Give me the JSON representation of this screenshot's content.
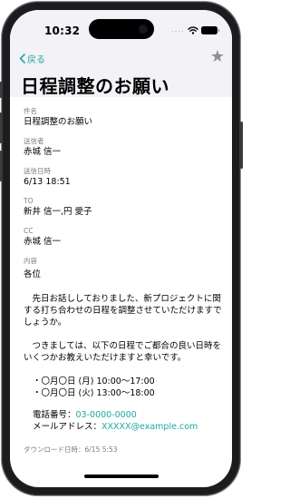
{
  "status_bar": {
    "time": "10:32",
    "dots": "...."
  },
  "nav": {
    "back_label": "戻る"
  },
  "title": "日程調整のお願い",
  "fields": [
    {
      "label": "件名",
      "value": "日程調整のお願い"
    },
    {
      "label": "送信者",
      "value": "赤城 信一"
    },
    {
      "label": "送信日時",
      "value": "6/13 18:51"
    },
    {
      "label": "TO",
      "value": "新井 信一,円 愛子"
    },
    {
      "label": "CC",
      "value": "赤城 信一"
    }
  ],
  "content": {
    "label": "内容",
    "greeting": "各位",
    "paragraph1": "先日お話ししておりました、新プロジェクトに関する打ち合わせの日程を調整させていただけますでしょうか。",
    "paragraph2": "つきましては、以下の日程でご都合の良い日時をいくつかお教えいただけますと幸いです。",
    "dates": [
      "・〇月〇日 (月) 10:00～17:00",
      "・〇月〇日 (火) 13:00～18:00"
    ],
    "phone_label": "電話番号：",
    "phone": "03-0000-0000",
    "mail_label": "メールアドレス：",
    "mail": "XXXXX@example.com"
  },
  "download_info": "ダウンロード日時：6/15 5:53",
  "colors": {
    "accent": "#1fa8a5",
    "header_bg": "#f2f2f7",
    "label_gray": "#7d7d82"
  }
}
